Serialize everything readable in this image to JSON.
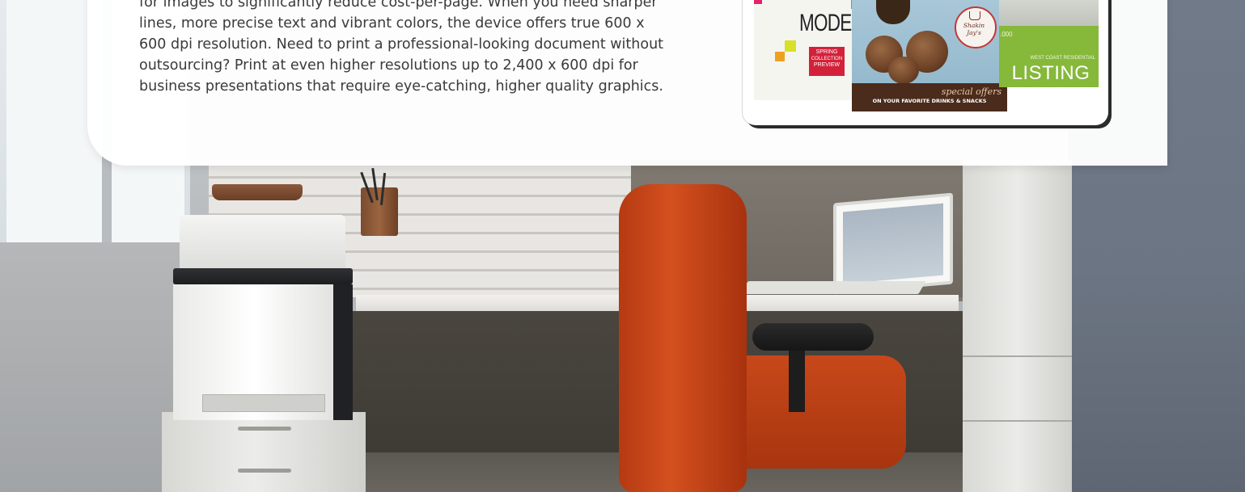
{
  "body_text": {
    "line1": "for images to significantly reduce cost-per-page. When you need sharper",
    "line2": "lines, more precise text and vibrant colors, the device offers true 600 x",
    "line3": "600 dpi resolution. Need to print a professional-looking document without",
    "line4": "outsourcing? Print at even higher resolutions up to 2,400 x 600 dpi for",
    "line5": "business presentations that require eye-catching, higher quality graphics."
  },
  "samples": {
    "mode": {
      "title": "MODE",
      "badge_line1": "SPRING",
      "badge_line2": "COLLECTION",
      "badge_line3": "PREVIEW"
    },
    "cafe": {
      "logo": "Shakin Jay's",
      "headline": "special offers",
      "subline": "ON YOUR FAVORITE DRINKS & SNACKS"
    },
    "listing": {
      "price": ".000",
      "subtitle": "WEST COAST RESIDENTIAL",
      "title": "LISTING"
    }
  },
  "colors": {
    "card_background": "#ffffff",
    "text": "#3a3a3a",
    "chair": "#c7481a",
    "listing_green": "#86b83a",
    "mode_red": "#d3213a"
  }
}
